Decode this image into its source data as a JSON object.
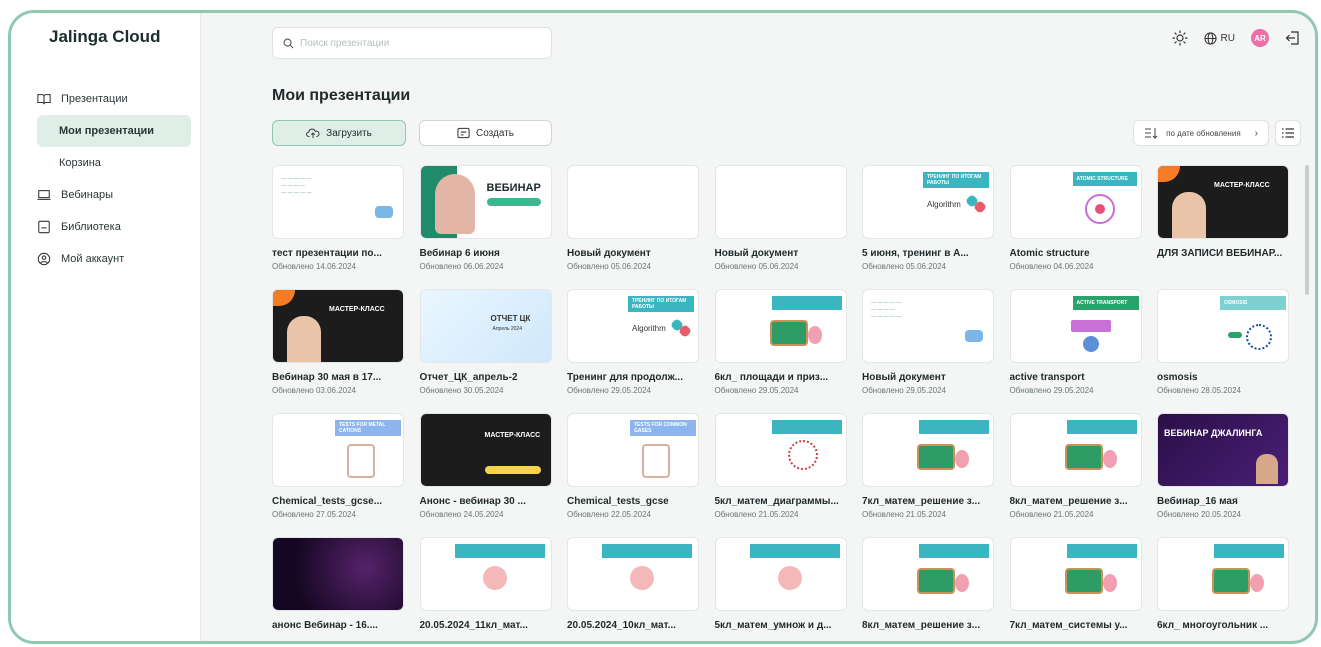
{
  "app": {
    "title": "Jalinga Cloud"
  },
  "sidebar": {
    "items": [
      {
        "label": "Презентации",
        "icon": "book-icon"
      },
      {
        "label": "Мои презентации",
        "icon": ""
      },
      {
        "label": "Корзина",
        "icon": ""
      },
      {
        "label": "Вебинары",
        "icon": "laptop-icon"
      },
      {
        "label": "Библиотека",
        "icon": "library-icon"
      },
      {
        "label": "Мой аккаунт",
        "icon": "user-icon"
      }
    ]
  },
  "search": {
    "placeholder": "Поиск презентации"
  },
  "header": {
    "language": "RU",
    "avatar_initials": "AR"
  },
  "main": {
    "title": "Мои презентации",
    "upload_label": "Загрузить",
    "create_label": "Создать",
    "sort_label": "по дате обновления"
  },
  "cards": [
    {
      "title": "тест презентации по...",
      "date": "Обновлено 14.06.2024",
      "thumb": "white-notes"
    },
    {
      "title": "Вебинар 6 июня",
      "date": "Обновлено 06.06.2024",
      "thumb": "webinar-green"
    },
    {
      "title": "Новый документ",
      "date": "Обновлено 05.06.2024",
      "thumb": "blank"
    },
    {
      "title": "Новый документ",
      "date": "Обновлено 05.06.2024",
      "thumb": "blank"
    },
    {
      "title": "5 июня, тренинг в A...",
      "date": "Обновлено 05.06.2024",
      "thumb": "algorithm"
    },
    {
      "title": "Atomic structure",
      "date": "Обновлено 04.06.2024",
      "thumb": "atomic"
    },
    {
      "title": "ДЛЯ ЗАПИСИ ВЕБИНАР...",
      "date": "",
      "thumb": "masterclass-dark"
    },
    {
      "title": "Вебинар 30 мая в 17...",
      "date": "Обновлено 03.06.2024",
      "thumb": "masterclass-dark"
    },
    {
      "title": "Отчет_ЦК_апрель-2",
      "date": "Обновлено 30.05.2024",
      "thumb": "report"
    },
    {
      "title": "Тренинг для продолж...",
      "date": "Обновлено 29.05.2024",
      "thumb": "algorithm"
    },
    {
      "title": "6кл_ площади и приз...",
      "date": "Обновлено 29.05.2024",
      "thumb": "teal-board"
    },
    {
      "title": "Новый документ",
      "date": "Обновлено 29.05.2024",
      "thumb": "white-notes"
    },
    {
      "title": "active transport",
      "date": "Обновлено 29.05.2024",
      "thumb": "active-transport"
    },
    {
      "title": "osmosis",
      "date": "Обновлено 28.05.2024",
      "thumb": "osmosis"
    },
    {
      "title": "Chemical_tests_gcse...",
      "date": "Обновлено 27.05.2024",
      "thumb": "chem-tests"
    },
    {
      "title": "Анонс - вебинар 30 ...",
      "date": "Обновлено 24.05.2024",
      "thumb": "masterclass-black"
    },
    {
      "title": "Chemical_tests_gcse",
      "date": "Обновлено 22.05.2024",
      "thumb": "chem-tests"
    },
    {
      "title": "5кл_матем_диаграммы...",
      "date": "Обновлено 21.05.2024",
      "thumb": "teal-diagram"
    },
    {
      "title": "7кл_матем_решение з...",
      "date": "Обновлено 21.05.2024",
      "thumb": "teal-board"
    },
    {
      "title": "8кл_матем_решение з...",
      "date": "Обновлено 21.05.2024",
      "thumb": "teal-board"
    },
    {
      "title": "Вебинар_16 мая",
      "date": "Обновлено 20.05.2024",
      "thumb": "webinar-purple"
    },
    {
      "title": "анонс Вебинар - 16....",
      "date": "",
      "thumb": "purple-dark"
    },
    {
      "title": "20.05.2024_11кл_мат...",
      "date": "",
      "thumb": "teal-circle"
    },
    {
      "title": "20.05.2024_10кл_мат...",
      "date": "",
      "thumb": "teal-circle"
    },
    {
      "title": "5кл_матем_умнож и д...",
      "date": "",
      "thumb": "teal-circle"
    },
    {
      "title": "8кл_матем_решение з...",
      "date": "",
      "thumb": "teal-board"
    },
    {
      "title": "7кл_матем_системы у...",
      "date": "",
      "thumb": "teal-board"
    },
    {
      "title": "6кл_ многоугольник ...",
      "date": "",
      "thumb": "teal-board"
    }
  ],
  "thumb_texts": {
    "webinar": "ВЕБИНАР",
    "masterclass": "МАСТЕР-КЛАСС",
    "algorithm": "Algorithm",
    "atomic": "ATOMIC STRUCTURE",
    "active": "ACTIVE TRANSPORT",
    "osmosis": "OSMOSIS",
    "report": "ОТЧЕТ ЦК",
    "report_sub": "Апрель 2024",
    "tests_metal": "TESTS FOR METAL CATIONS",
    "tests_gases": "TESTS FOR COMMON GASES",
    "webinar_jalinga": "ВЕБИНАР ДЖАЛИНГА",
    "training": "ТРЕНИНГ ПО ИТОГАМ РАБОТЫ"
  },
  "colors": {
    "accent": "#8fc9b0",
    "accent_bg": "#dfeee6",
    "teal": "#3bb6c0",
    "avatar": "#ee6fa8"
  }
}
